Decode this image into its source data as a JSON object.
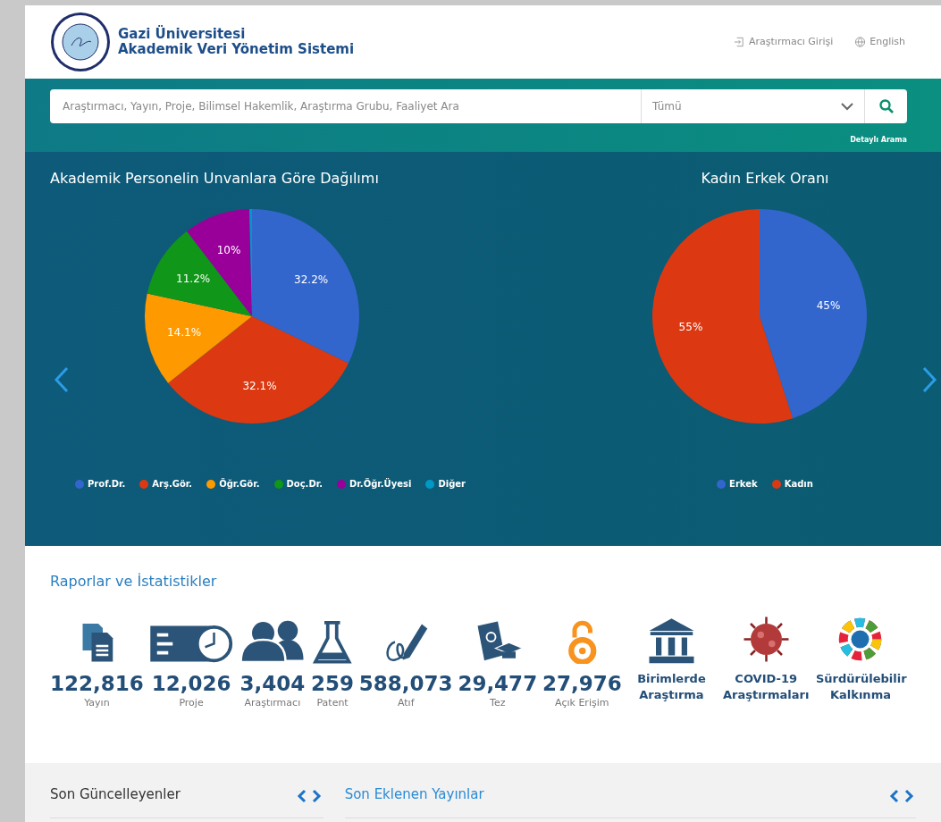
{
  "header": {
    "title_line1": "Gazi Üniversitesi",
    "title_line2": "Akademik Veri Yönetim Sistemi",
    "links": [
      {
        "kind": "login",
        "label": "Araştırmacı Girişi"
      },
      {
        "kind": "language",
        "label": "English"
      }
    ]
  },
  "search": {
    "placeholder": "Araştırmacı, Yayın, Proje, Bilimsel Hakemlik, Araştırma Grubu, Faaliyet Ara",
    "scope": "Tümü",
    "advanced_link": "Detaylı Arama"
  },
  "charts": [
    {
      "title": "Akademik Personelin Unvanlara Göre Dağılımı",
      "chart_data": {
        "type": "pie",
        "categories": [
          "Prof.Dr.",
          "Arş.Gör.",
          "Öğr.Gör.",
          "Doç.Dr.",
          "Dr.Öğr.Üyesi",
          "Diğer"
        ],
        "values": [
          32.2,
          32.1,
          14.1,
          11.2,
          10,
          0.4
        ],
        "colors": [
          "#3366cc",
          "#dc3912",
          "#ff9900",
          "#109618",
          "#990099",
          "#0099c6"
        ],
        "value_labels": [
          "32.2%",
          "32.1%",
          "14.1%",
          "11.2%",
          "10%",
          null
        ]
      }
    },
    {
      "title": "Kadın Erkek Oranı",
      "chart_data": {
        "type": "pie",
        "categories": [
          "Erkek",
          "Kadın"
        ],
        "values": [
          45,
          55
        ],
        "colors": [
          "#3366cc",
          "#dc3912"
        ],
        "value_labels": [
          "45%",
          "55%"
        ]
      }
    }
  ],
  "reports": {
    "title": "Raporlar ve İstatistikler",
    "items": [
      {
        "kind": "count",
        "value": "122,816",
        "label": "Yayın"
      },
      {
        "kind": "count",
        "value": "12,026",
        "label": "Proje"
      },
      {
        "kind": "count",
        "value": "3,404",
        "label": "Araştırmacı"
      },
      {
        "kind": "count",
        "value": "259",
        "label": "Patent"
      },
      {
        "kind": "count",
        "value": "588,073",
        "label": "Atıf"
      },
      {
        "kind": "count",
        "value": "29,477",
        "label": "Tez"
      },
      {
        "kind": "count",
        "value": "27,976",
        "label": "Açık Erişim"
      },
      {
        "kind": "link",
        "label": "Birimlerde Araştırma"
      },
      {
        "kind": "link",
        "label": "COVID-19 Araştırmaları"
      },
      {
        "kind": "link",
        "label": "Sürdürülebilir Kalkınma"
      }
    ]
  },
  "panels": [
    {
      "title": "Son Güncelleyenler",
      "selected": false
    },
    {
      "title": "Son Eklenen Yayınlar",
      "selected": true
    }
  ]
}
